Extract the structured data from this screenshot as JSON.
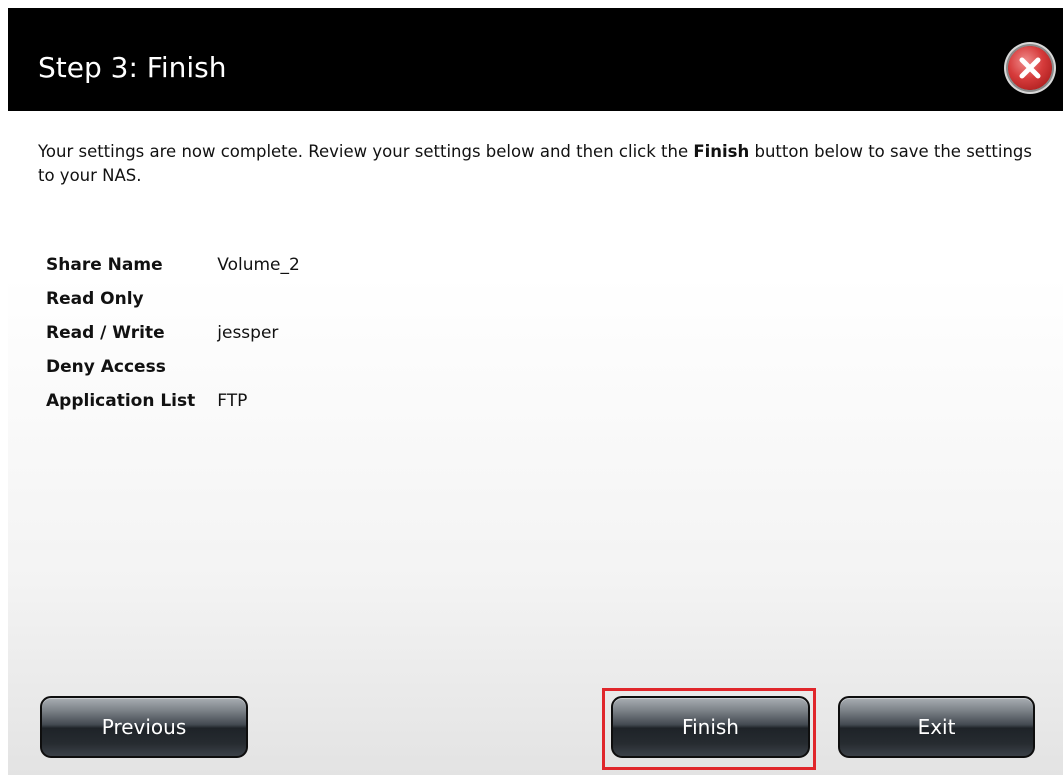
{
  "dialog": {
    "title": "Step 3: Finish",
    "close_icon": "close-icon"
  },
  "intro": {
    "part1": "Your settings are now complete. Review your settings below and then click the ",
    "bold": "Finish",
    "part2": " button below to save the settings to your NAS."
  },
  "settings": [
    {
      "label": "Share Name",
      "value": "Volume_2"
    },
    {
      "label": "Read Only",
      "value": ""
    },
    {
      "label": "Read / Write",
      "value": "jessper"
    },
    {
      "label": "Deny Access",
      "value": ""
    },
    {
      "label": "Application List",
      "value": "FTP"
    }
  ],
  "buttons": {
    "previous": "Previous",
    "finish": "Finish",
    "exit": "Exit"
  },
  "colors": {
    "titlebar": "#000000",
    "highlight": "#e0262b",
    "close": "#d63b3b"
  }
}
